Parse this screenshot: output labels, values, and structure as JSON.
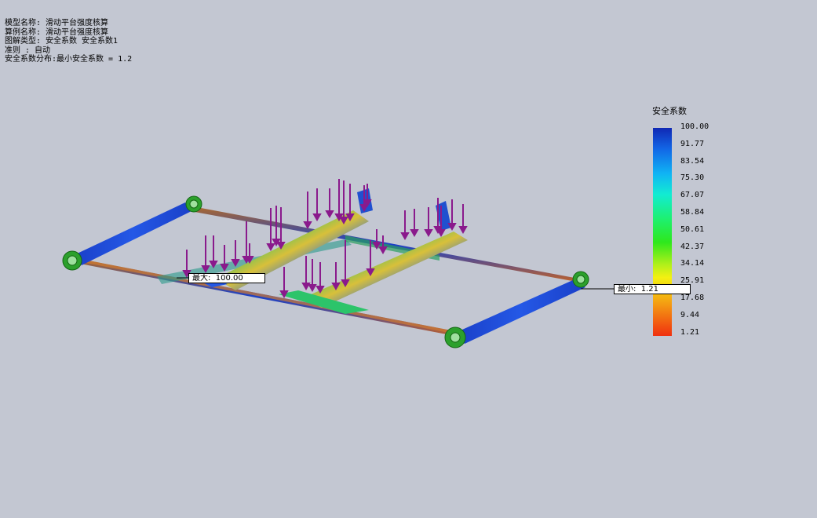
{
  "info": {
    "line1": "模型名称: 滑动平台强度核算",
    "line2": "算例名称: 滑动平台强度核算",
    "line3": "图解类型: 安全系数 安全系数1",
    "line4": "准则 : 自动",
    "line5": "安全系数分布:最小安全系数 = 1.2"
  },
  "legend": {
    "title": "安全系数",
    "ticks": [
      "100.00",
      "91.77",
      "83.54",
      "75.30",
      "67.07",
      "58.84",
      "50.61",
      "42.37",
      "34.14",
      "25.91",
      "17.68",
      "9.44",
      "1.21"
    ]
  },
  "markers": {
    "max_text": "最大:  100.00",
    "min_text": "最小:  1.21"
  },
  "colors": {
    "background": "#c3c7d2",
    "load_arrow": "#8a1a8c",
    "fixture": "#2ca02c"
  }
}
